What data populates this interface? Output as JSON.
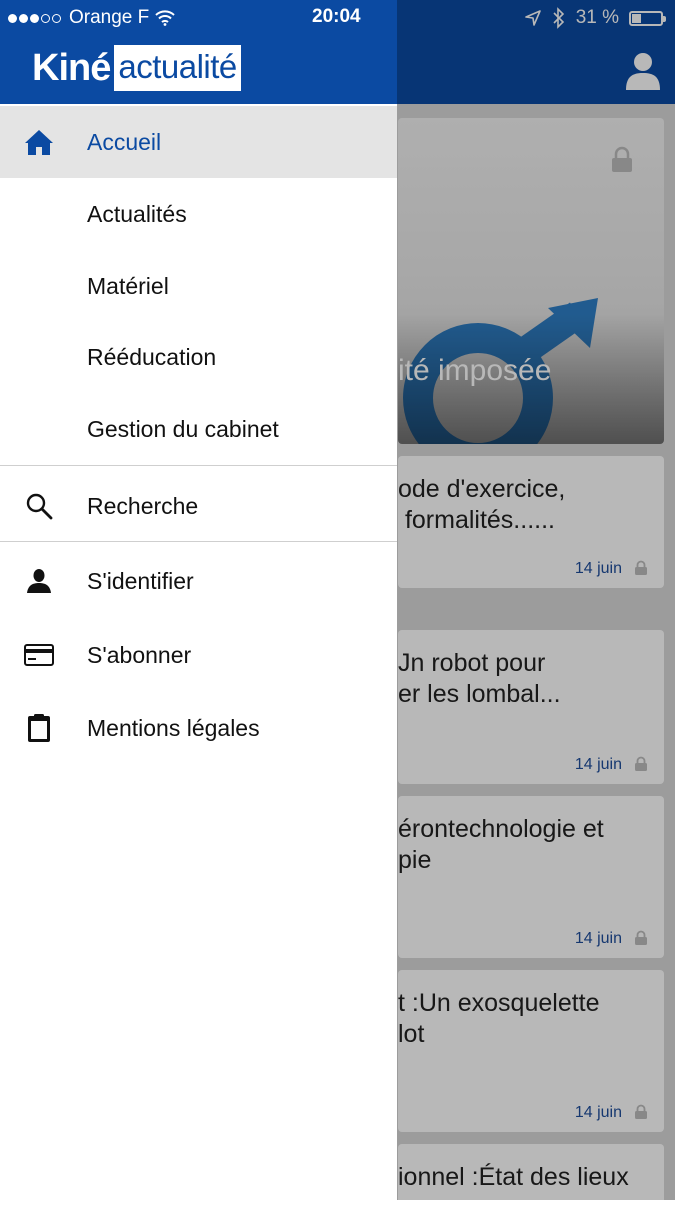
{
  "status_bar": {
    "carrier": "Orange F",
    "time": "20:04",
    "battery": "31 %",
    "battery_level": 0.31
  },
  "app_logo": {
    "part1": "Kiné",
    "part2": "actualité"
  },
  "menu": {
    "primary": [
      {
        "label": "Accueil",
        "icon": "home-icon",
        "selected": true
      },
      {
        "label": "Actualités"
      },
      {
        "label": "Matériel"
      },
      {
        "label": "Rééducation"
      },
      {
        "label": "Gestion du cabinet"
      }
    ],
    "search": {
      "label": "Recherche",
      "icon": "search-icon"
    },
    "account": [
      {
        "label": "S'identifier",
        "icon": "user-icon"
      },
      {
        "label": "S'abonner",
        "icon": "credit-card-icon"
      },
      {
        "label": "Mentions légales",
        "icon": "clipboard-icon"
      }
    ]
  },
  "background": {
    "feature": {
      "title": "ité imposée"
    },
    "articles": [
      {
        "title": "ode d'exercice,\n formalités......",
        "date": "14 juin"
      },
      {
        "title": "Jn robot pour\ner les lombal...",
        "date": "14 juin"
      },
      {
        "title": "érontechnologie et\npie",
        "date": "14 juin"
      },
      {
        "title": "t :Un exosquelette\nlot",
        "date": "14 juin"
      },
      {
        "title": "ionnel :État des lieux",
        "date": ""
      }
    ]
  },
  "colors": {
    "brand_blue": "#0b4aa2",
    "date_blue": "#1f4e9c",
    "selected_bg": "#e4e4e4"
  }
}
